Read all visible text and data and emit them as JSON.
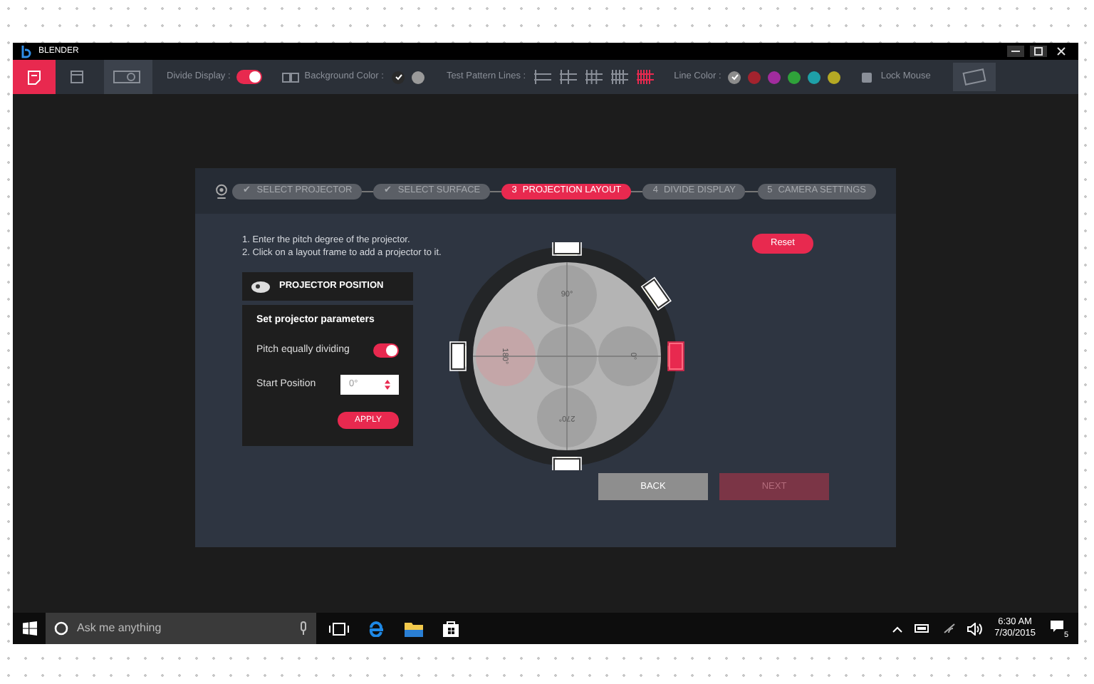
{
  "window": {
    "title": "BLENDER"
  },
  "toolbar": {
    "modes": [
      {
        "selected": true
      },
      {
        "selected": false
      },
      {
        "selected": false
      }
    ],
    "divide_display": {
      "label": "Divide Display :",
      "on": true
    },
    "background_color": {
      "label": "Background Color :",
      "options": [
        {
          "color": "#2a2a2a",
          "selected": true
        },
        {
          "color": "#9a9a9a",
          "selected": false
        }
      ]
    },
    "test_pattern_lines": {
      "label": "Test Pattern Lines :",
      "options": [
        {
          "selected": false
        },
        {
          "selected": false
        },
        {
          "selected": false
        },
        {
          "selected": false
        },
        {
          "selected": true
        }
      ]
    },
    "line_color": {
      "label": "Line Color :",
      "options": [
        {
          "color": "#8c8c8c",
          "selected": true
        },
        {
          "color": "#a3232e",
          "selected": false
        },
        {
          "color": "#a12c9e",
          "selected": false
        },
        {
          "color": "#2fa23a",
          "selected": false
        },
        {
          "color": "#1ea0a8",
          "selected": false
        },
        {
          "color": "#b5a924",
          "selected": false
        }
      ]
    },
    "lock_mouse": {
      "label": "Lock Mouse",
      "checked": false
    }
  },
  "steps": [
    {
      "number": "✔",
      "label": "SELECT PROJECTOR",
      "selected": false
    },
    {
      "number": "✔",
      "label": "SELECT SURFACE",
      "selected": false
    },
    {
      "number": "3",
      "label": "PROJECTION LAYOUT",
      "selected": true
    },
    {
      "number": "4",
      "label": "DIVIDE DISPLAY",
      "selected": false
    },
    {
      "number": "5",
      "label": "CAMERA SETTINGS",
      "selected": false
    }
  ],
  "instructions": [
    "1. Enter the pitch degree of the projector.",
    "2. Click on a layout frame to add a projector to it."
  ],
  "reset_button": "Reset",
  "projector_position": {
    "title": "PROJECTOR POSITION",
    "subtitle": "Set projector parameters",
    "pitch_label": "Pitch equally dividing",
    "pitch_on": true,
    "start_label": "Start Position",
    "start_value": "0°",
    "apply_button": "APPLY"
  },
  "layout": {
    "labels": [
      "90°",
      "180°",
      "0°",
      "270°"
    ],
    "projectors": [
      {
        "selected": false
      },
      {
        "selected": false
      },
      {
        "selected": false
      },
      {
        "selected": true
      },
      {
        "selected": false
      }
    ]
  },
  "buttons": [
    {
      "label": "BACK",
      "disabled": false
    },
    {
      "label": "NEXT",
      "disabled": true
    }
  ],
  "taskbar": {
    "search_placeholder": "Ask me anything",
    "time": "6:30 AM",
    "date": "7/30/2015",
    "notifications": "5"
  }
}
